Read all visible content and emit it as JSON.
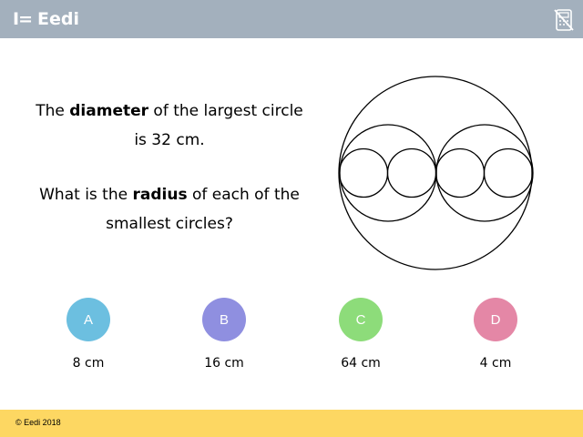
{
  "header": {
    "logo_mark": "I=",
    "logo_text": "Eedi",
    "calculator_icon": "calculator-crossed-icon",
    "background": "#a3b0bd"
  },
  "question": {
    "line1_pre": "The ",
    "line1_bold": "diameter",
    "line1_post": " of the largest circle",
    "line2": "is 32 cm.",
    "line3_pre": "What is the ",
    "line3_bold": "radius",
    "line3_post": " of each of the",
    "line4": "smallest circles?"
  },
  "options": [
    {
      "letter": "A",
      "answer": "8 cm",
      "color": "#6cbfe0"
    },
    {
      "letter": "B",
      "answer": "16 cm",
      "color": "#8f8fe0"
    },
    {
      "letter": "C",
      "answer": "64 cm",
      "color": "#8ddc7a"
    },
    {
      "letter": "D",
      "answer": "4 cm",
      "color": "#e487a6"
    }
  ],
  "footer": {
    "copyright": "© Eedi 2018",
    "background": "#fdd762"
  }
}
